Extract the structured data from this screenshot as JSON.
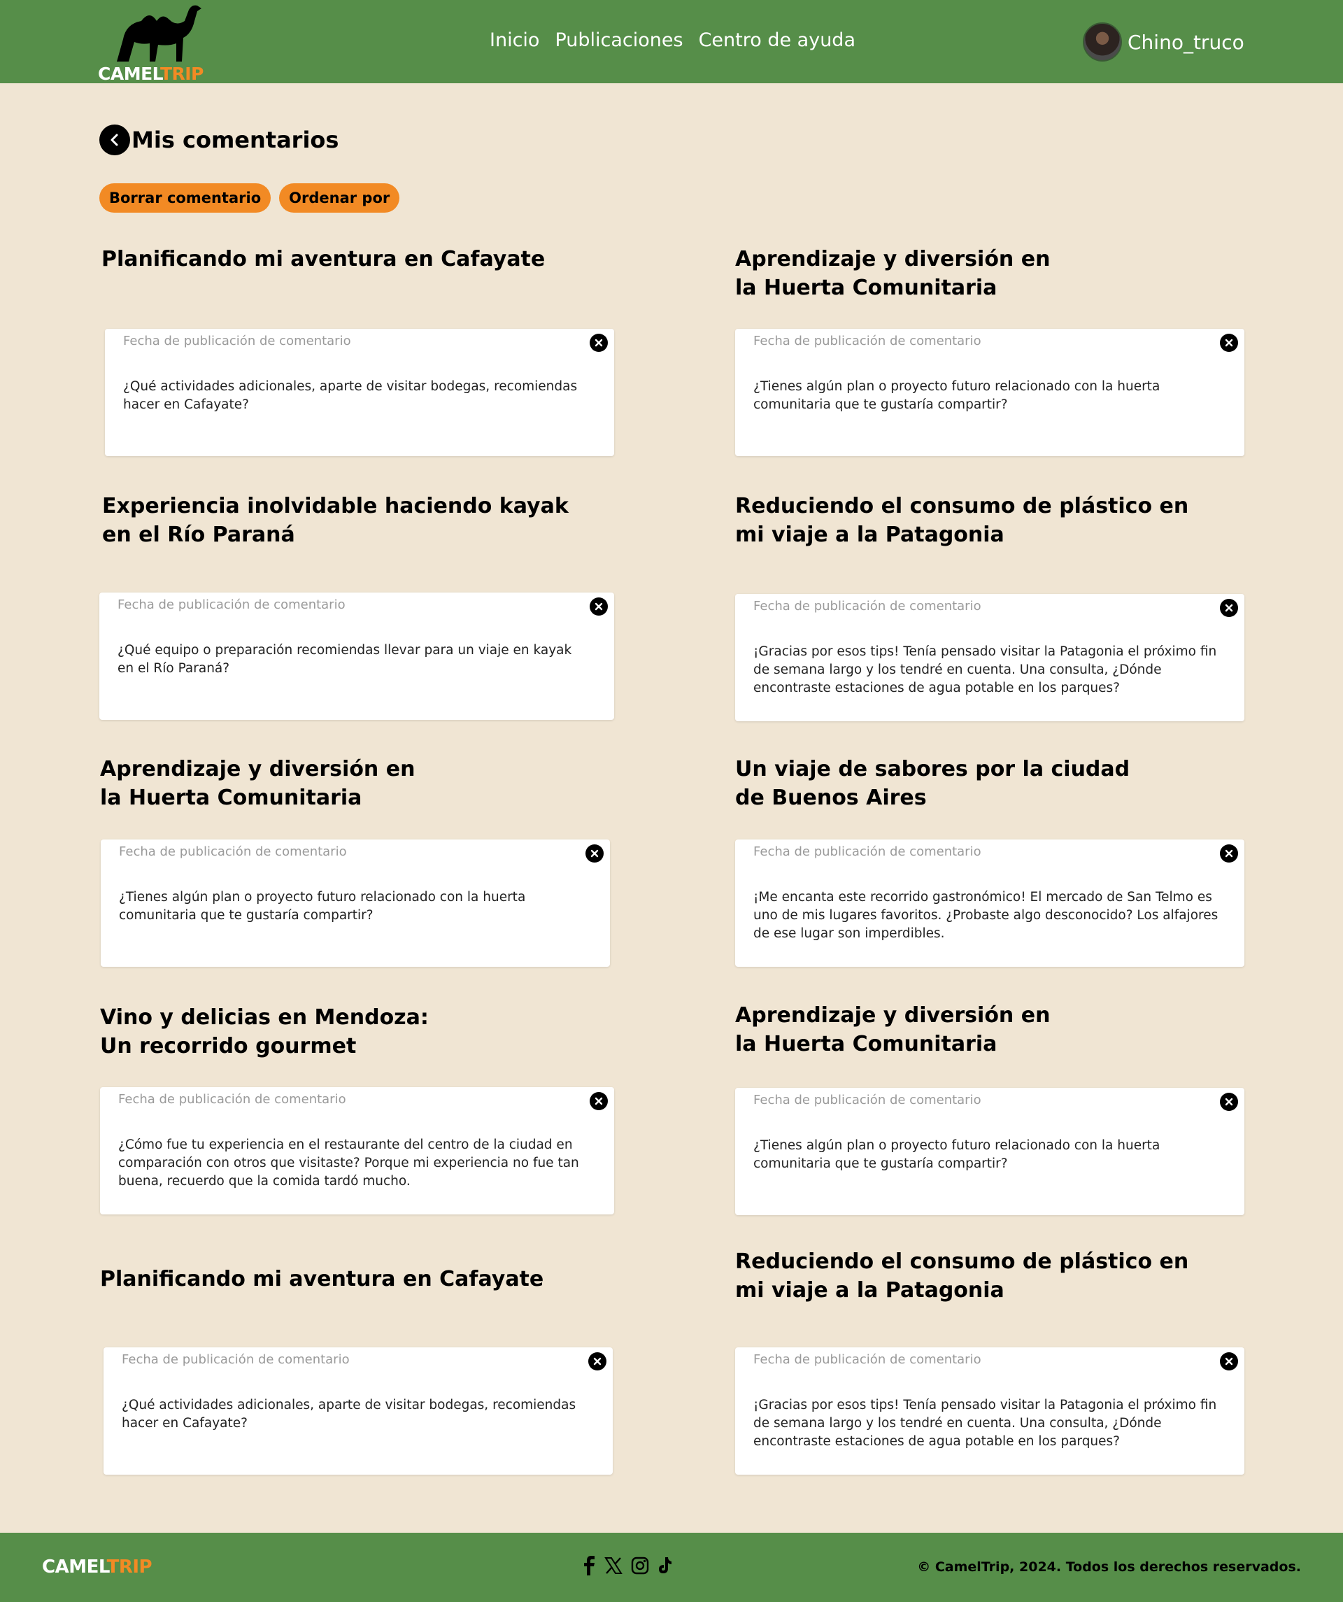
{
  "header": {
    "logo": {
      "part1": "CAMEL",
      "part2": "TRIP"
    },
    "nav": [
      "Inicio",
      "Publicaciones",
      "Centro de ayuda"
    ],
    "username": "Chino_truco"
  },
  "page": {
    "title": "Mis comentarios",
    "delete_button": "Borrar comentario",
    "sort_button": "Ordenar por"
  },
  "posts": [
    {
      "title": "Planificando mi aventura en Cafayate",
      "date_placeholder": "Fecha de publicación de comentario",
      "comment": "¿Qué actividades adicionales, aparte de visitar bodegas, recomiendas hacer en Cafayate?"
    },
    {
      "title": "Aprendizaje y diversión en\nla Huerta Comunitaria",
      "date_placeholder": "Fecha de publicación de comentario",
      "comment": "¿Tienes algún plan o proyecto futuro relacionado con la huerta comunitaria que te gustaría compartir?"
    },
    {
      "title": "Experiencia inolvidable haciendo kayak\nen el Río Paraná",
      "date_placeholder": "Fecha de publicación de comentario",
      "comment": "¿Qué equipo o preparación recomiendas llevar para un viaje en kayak en el Río Paraná?"
    },
    {
      "title": "Reduciendo el consumo de plástico en\nmi viaje a la Patagonia",
      "date_placeholder": "Fecha de publicación de comentario",
      "comment": "¡Gracias por esos tips! Tenía pensado visitar la Patagonia el próximo fin de semana largo y los tendré en cuenta. Una consulta, ¿Dónde encontraste estaciones de agua potable en los parques?"
    },
    {
      "title": "Aprendizaje y diversión en\nla Huerta Comunitaria",
      "date_placeholder": "Fecha de publicación de comentario",
      "comment": "¿Tienes algún plan o proyecto futuro relacionado con la huerta comunitaria que te gustaría compartir?"
    },
    {
      "title": "Un viaje de sabores por la ciudad\nde Buenos Aires",
      "date_placeholder": "Fecha de publicación de comentario",
      "comment": "¡Me encanta este recorrido gastronómico! El mercado de San Telmo es uno de mis lugares favoritos. ¿Probaste algo desconocido? Los alfajores de ese lugar son imperdibles."
    },
    {
      "title": "Vino y delicias en Mendoza:\nUn recorrido gourmet",
      "date_placeholder": "Fecha de publicación de comentario",
      "comment": "¿Cómo fue tu experiencia en el restaurante del centro de la ciudad en comparación con otros que visitaste? Porque mi experiencia no fue tan buena, recuerdo que la comida tardó mucho."
    },
    {
      "title": "Aprendizaje y diversión en\nla Huerta Comunitaria",
      "date_placeholder": "Fecha de publicación de comentario",
      "comment": "¿Tienes algún plan o proyecto futuro relacionado con la huerta comunitaria que te gustaría compartir?"
    },
    {
      "title": "Planificando mi aventura en Cafayate",
      "date_placeholder": "Fecha de publicación de comentario",
      "comment": "¿Qué actividades adicionales, aparte de visitar bodegas, recomiendas hacer en Cafayate?"
    },
    {
      "title": "Reduciendo el consumo de plástico en\nmi viaje a la Patagonia",
      "date_placeholder": "Fecha de publicación de comentario",
      "comment": "¡Gracias por esos tips! Tenía pensado visitar la Patagonia el próximo fin de semana largo y los tendré en cuenta. Una consulta, ¿Dónde encontraste estaciones de agua potable en los parques?"
    }
  ],
  "footer": {
    "logo": {
      "part1": "CAMEL",
      "part2": "TRIP"
    },
    "socials": [
      "facebook-icon",
      "x-icon",
      "instagram-icon",
      "tiktok-icon"
    ],
    "copyright": "© CamelTrip, 2024. Todos los derechos reservados."
  },
  "colors": {
    "header_bg": "#568e49",
    "page_bg": "#f0e5d3",
    "accent": "#f28a24"
  }
}
